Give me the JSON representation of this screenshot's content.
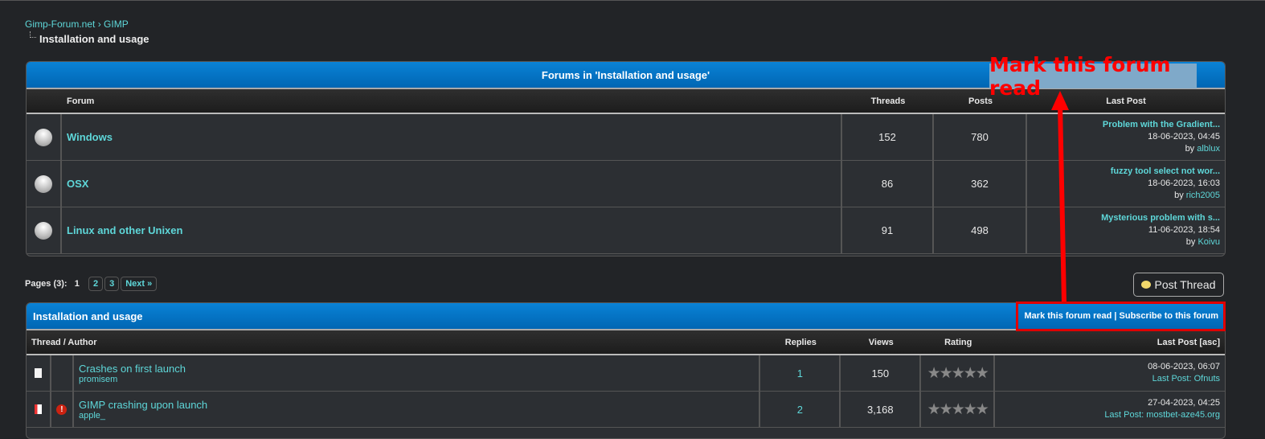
{
  "breadcrumb": {
    "root": "Gimp-Forum.net",
    "sep": "›",
    "parent": "GIMP",
    "current": "Installation and usage"
  },
  "subforums": {
    "title": "Forums in 'Installation and usage'",
    "columns": [
      "Forum",
      "Threads",
      "Posts",
      "Last Post"
    ],
    "rows": [
      {
        "name": "Windows",
        "threads": "152",
        "posts": "780",
        "last_title": "Problem with the Gradient...",
        "last_date": "18-06-2023, 04:45",
        "by": "by",
        "last_user": "alblux"
      },
      {
        "name": "OSX",
        "threads": "86",
        "posts": "362",
        "last_title": "fuzzy tool select not wor...",
        "last_date": "18-06-2023, 16:03",
        "by": "by",
        "last_user": "rich2005"
      },
      {
        "name": "Linux and other Unixen",
        "threads": "91",
        "posts": "498",
        "last_title": "Mysterious problem with s...",
        "last_date": "11-06-2023, 18:54",
        "by": "by",
        "last_user": "Koivu"
      }
    ]
  },
  "pagination": {
    "label": "Pages (3):",
    "current": "1",
    "pages": [
      "2",
      "3"
    ],
    "next": "Next »"
  },
  "post_thread": "Post Thread",
  "threads": {
    "title": "Installation and usage",
    "mark_read": "Mark this forum read",
    "sep": "|",
    "subscribe": "Subscribe to this forum",
    "columns": [
      "Thread / Author",
      "Replies",
      "Views",
      "Rating",
      "Last Post [asc]"
    ],
    "rows": [
      {
        "title": "Crashes on first launch",
        "author": "promisem",
        "replies": "1",
        "views": "150",
        "rating": "★★★★★",
        "date": "08-06-2023, 06:07",
        "last_label": "Last Post:",
        "last_user": "Ofnuts"
      },
      {
        "title": "GIMP crashing upon launch",
        "author": "apple_",
        "replies": "2",
        "views": "3,168",
        "rating": "★★★★★",
        "date": "27-04-2023, 04:25",
        "last_label": "Last Post:",
        "last_user": "mostbet-aze45.org"
      }
    ]
  },
  "annotation": {
    "text": "Mark this forum read",
    "color": "#ff0000"
  }
}
